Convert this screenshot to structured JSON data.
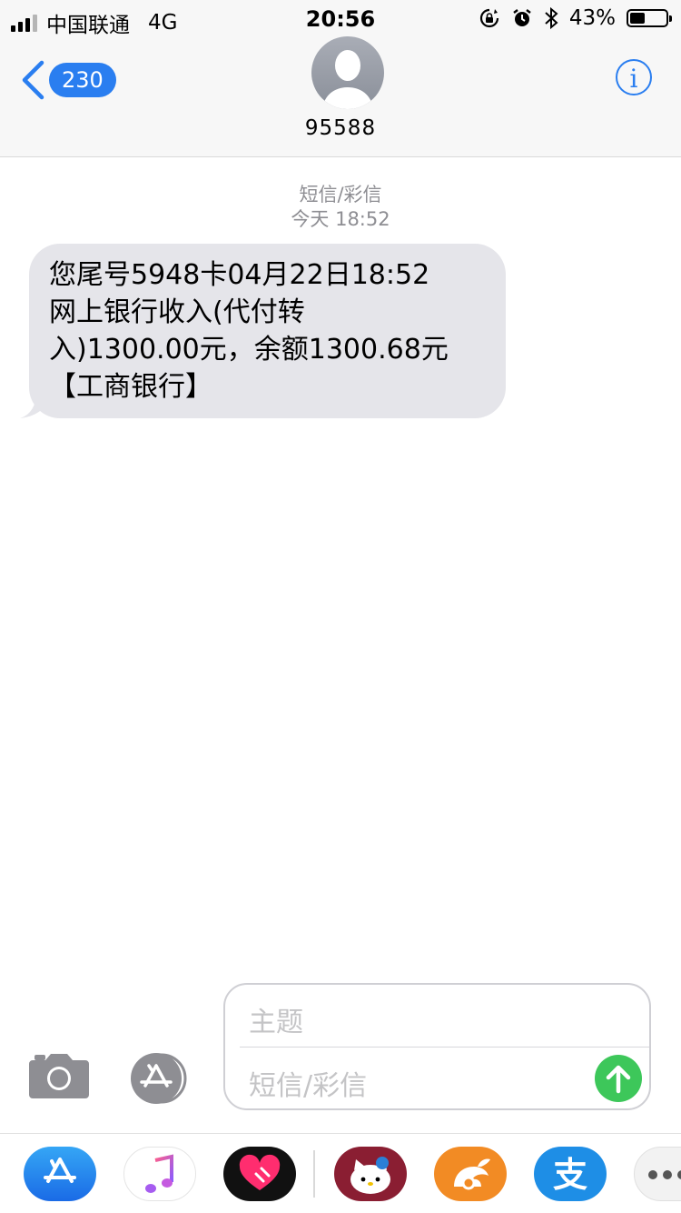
{
  "status": {
    "carrier": "中国联通",
    "network": "4G",
    "time": "20:56",
    "battery_pct": "43%",
    "battery_level": 0.43
  },
  "header": {
    "back_count": "230",
    "contact": "95588"
  },
  "conversation": {
    "type_label": "短信/彩信",
    "day": "今天",
    "time": "18:52",
    "message": {
      "line1": "您尾号5948卡04月22日18:52",
      "line2": "网上银行收入(代付转",
      "line3": "入)1300.00元，余额1300.68元",
      "line4": "【工商银行】"
    }
  },
  "composer": {
    "subject_placeholder": "主题",
    "message_placeholder": "短信/彩信"
  },
  "drawer": {
    "apps": [
      "app-store-icon",
      "music-icon",
      "digital-touch-icon",
      "hello-kitty-sticker-icon",
      "uc-browser-icon",
      "alipay-icon",
      "more-icon"
    ],
    "alipay_glyph": "支"
  },
  "colors": {
    "accent": "#2a7ef0",
    "bubble": "#e5e5ea",
    "send": "#3dc75a"
  }
}
